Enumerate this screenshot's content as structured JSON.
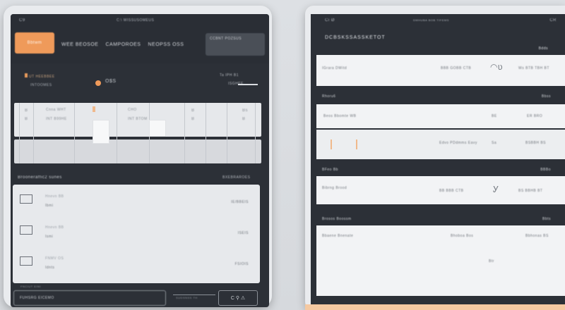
{
  "left": {
    "status_left": "C9",
    "status_center": "C:\\ WISSUSOMEUS",
    "primary_button": "Bbtwm",
    "nav": [
      "WEE BEOSOE",
      "CAMPOROES",
      "NEOPSS OSS"
    ],
    "top_right_button": "CCBNT POZSUS",
    "account_label": "UT HEEBBEE",
    "account_sub": "INTOOMES",
    "account_code": "O$S",
    "right_top_label": "Ta IPH B1",
    "right_sub_label": "ISGHEE",
    "table_cells": {
      "c1_top": "B",
      "c1_bot": "B",
      "c2_top": "Cnna WHT",
      "c2_mid": "INT B99HE",
      "c3_top": "CHO",
      "c3_mid": "INT BTOM",
      "c4_top": "B",
      "c4_bot": "B",
      "c5_top": "Bs",
      "c5_bot": "B"
    },
    "section_title": "Brooneraffic2 sunes",
    "section_right": "BXEBRAROES",
    "list_items": [
      {
        "title": "Hnevn BB",
        "subtitle": "Ibmi",
        "right": "IE/BBEIS"
      },
      {
        "title": "Hnevn BB",
        "subtitle": "Ismi",
        "right": "ISEIS"
      },
      {
        "title": "FNMV OS",
        "subtitle": "Idnts",
        "right": "FSIOIS"
      }
    ],
    "footer_label": "FNCIUT EINI",
    "input_value": "FUHSRG EICEMO",
    "footer_mid": "SUDSNSS TH",
    "footer_button": "C  ⚲  ⚠"
  },
  "right": {
    "status_left": "Ci  Ø",
    "status_center": "DMHUBA BOB TIFEMS",
    "status_right": "CR",
    "title": "DCBSKSSASSKETOT",
    "header_right": "Bdds",
    "cards": [
      {
        "left": "IGrara DWitd",
        "mid": "BBB GOBB CTB",
        "glyph": "◠ʋ",
        "right": "Ws BTB  TBH  BT"
      },
      {
        "header": "Rhoru6",
        "header_right": "Bbss",
        "row1": [
          "Beos Bbomte  WB",
          "BE",
          "ER  BRO"
        ],
        "row2": [
          "Edvo PDdmms Eavy",
          "Sa",
          "BSBBH  BS"
        ]
      },
      {
        "header": "BFeo Bb",
        "header_right": "BBBo",
        "left": "Bibrng Brood",
        "mid": "BB BBB CTB",
        "glyph": "Ꭹ",
        "right": "BS  BBHB  BT"
      },
      {
        "header": "Brosos Boossm",
        "header_right": "Bbts",
        "left": "Bbaene Bnenate",
        "mid": "Bhoboa Bos",
        "right": "Bbhonas  BS",
        "extra": "Btr"
      }
    ]
  }
}
